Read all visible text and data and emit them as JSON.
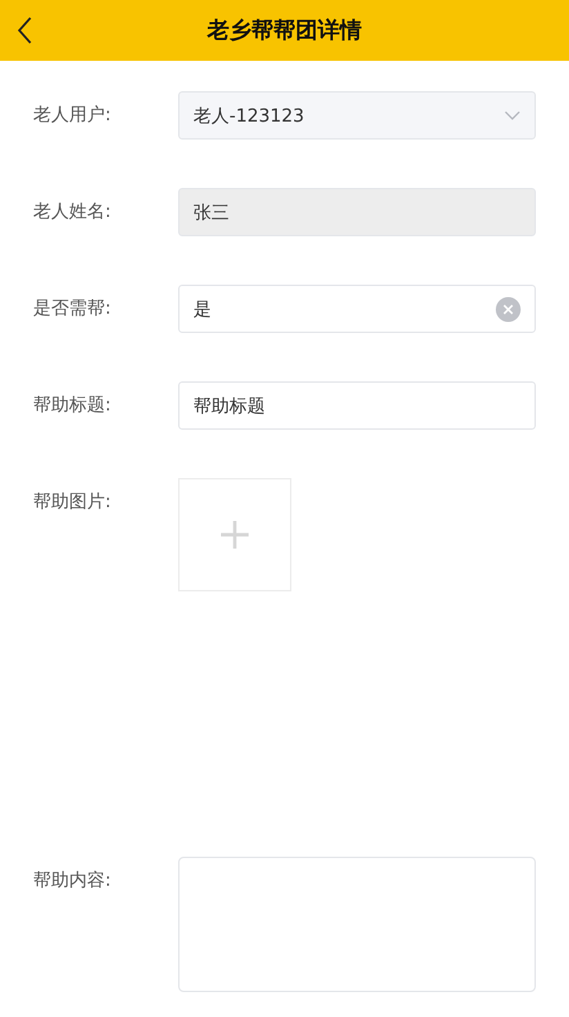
{
  "header": {
    "title": "老乡帮帮团详情"
  },
  "fields": [
    {
      "kind": "select",
      "label": "老人用户:",
      "value": "老人-123123"
    },
    {
      "kind": "readonly",
      "label": "老人姓名:",
      "value": "张三"
    },
    {
      "kind": "clearable",
      "label": "是否需帮:",
      "value": "是"
    },
    {
      "kind": "text",
      "label": "帮助标题:",
      "value": "帮助标题"
    },
    {
      "kind": "upload",
      "label": "帮助图片:"
    },
    {
      "kind": "textarea",
      "label": "帮助内容:"
    }
  ]
}
